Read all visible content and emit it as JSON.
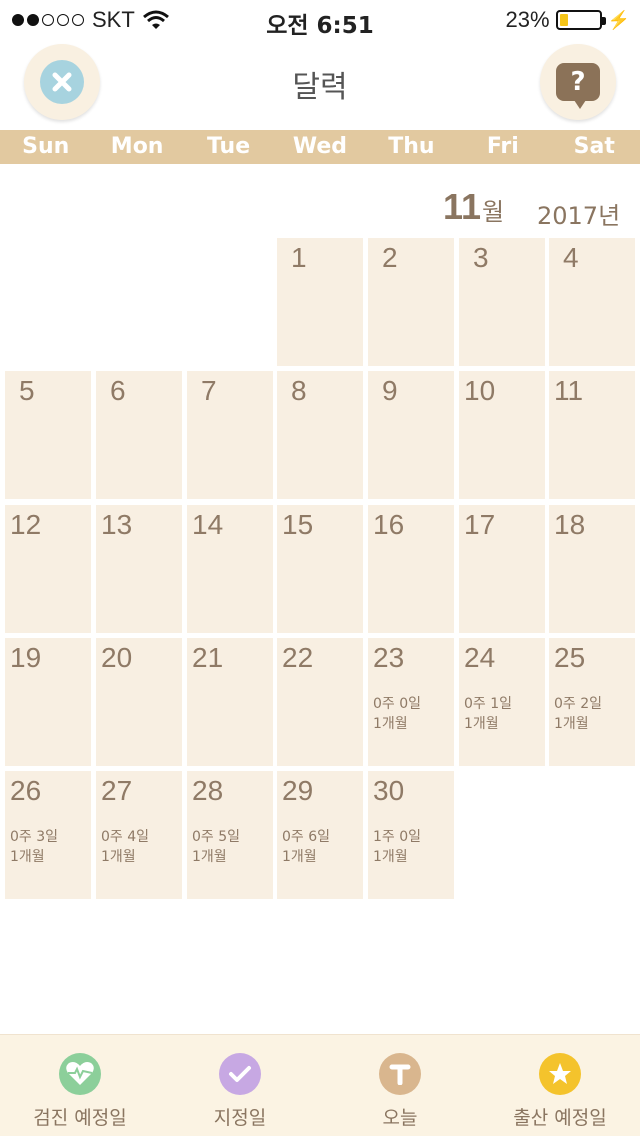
{
  "status": {
    "carrier": "SKT",
    "time": "오전 6:51",
    "battery": "23%",
    "battery_level": 0.23
  },
  "header": {
    "title": "달력",
    "close_icon": "close-icon",
    "help_icon": "question-icon"
  },
  "weekdays": [
    "Sun",
    "Mon",
    "Tue",
    "Wed",
    "Thu",
    "Fri",
    "Sat"
  ],
  "calendar": {
    "month": "11",
    "month_suffix": "월",
    "year": "2017년",
    "days": [
      {
        "day": "1",
        "info1": "",
        "info2": ""
      },
      {
        "day": "2",
        "info1": "",
        "info2": ""
      },
      {
        "day": "3",
        "info1": "",
        "info2": ""
      },
      {
        "day": "4",
        "info1": "",
        "info2": ""
      },
      {
        "day": "5",
        "info1": "",
        "info2": ""
      },
      {
        "day": "6",
        "info1": "",
        "info2": ""
      },
      {
        "day": "7",
        "info1": "",
        "info2": ""
      },
      {
        "day": "8",
        "info1": "",
        "info2": ""
      },
      {
        "day": "9",
        "info1": "",
        "info2": ""
      },
      {
        "day": "10",
        "info1": "",
        "info2": ""
      },
      {
        "day": "11",
        "info1": "",
        "info2": ""
      },
      {
        "day": "12",
        "info1": "",
        "info2": ""
      },
      {
        "day": "13",
        "info1": "",
        "info2": ""
      },
      {
        "day": "14",
        "info1": "",
        "info2": ""
      },
      {
        "day": "15",
        "info1": "",
        "info2": ""
      },
      {
        "day": "16",
        "info1": "",
        "info2": ""
      },
      {
        "day": "17",
        "info1": "",
        "info2": ""
      },
      {
        "day": "18",
        "info1": "",
        "info2": ""
      },
      {
        "day": "19",
        "info1": "",
        "info2": ""
      },
      {
        "day": "20",
        "info1": "",
        "info2": ""
      },
      {
        "day": "21",
        "info1": "",
        "info2": ""
      },
      {
        "day": "22",
        "info1": "",
        "info2": ""
      },
      {
        "day": "23",
        "info1": "0주 0일",
        "info2": "1개월"
      },
      {
        "day": "24",
        "info1": "0주 1일",
        "info2": "1개월"
      },
      {
        "day": "25",
        "info1": "0주 2일",
        "info2": "1개월"
      },
      {
        "day": "26",
        "info1": "0주 3일",
        "info2": "1개월"
      },
      {
        "day": "27",
        "info1": "0주 4일",
        "info2": "1개월"
      },
      {
        "day": "28",
        "info1": "0주 5일",
        "info2": "1개월"
      },
      {
        "day": "29",
        "info1": "0주 6일",
        "info2": "1개월"
      },
      {
        "day": "30",
        "info1": "1주 0일",
        "info2": "1개월"
      }
    ]
  },
  "bottom_nav": [
    {
      "label": "검진 예정일",
      "icon": "heart-pulse-icon",
      "color": "#8ccf9a"
    },
    {
      "label": "지정일",
      "icon": "check-icon",
      "color": "#c7a8e3"
    },
    {
      "label": "오늘",
      "icon": "t-icon",
      "color": "#d9b68e"
    },
    {
      "label": "출산 예정일",
      "icon": "star-icon",
      "color": "#f4c32c"
    }
  ]
}
